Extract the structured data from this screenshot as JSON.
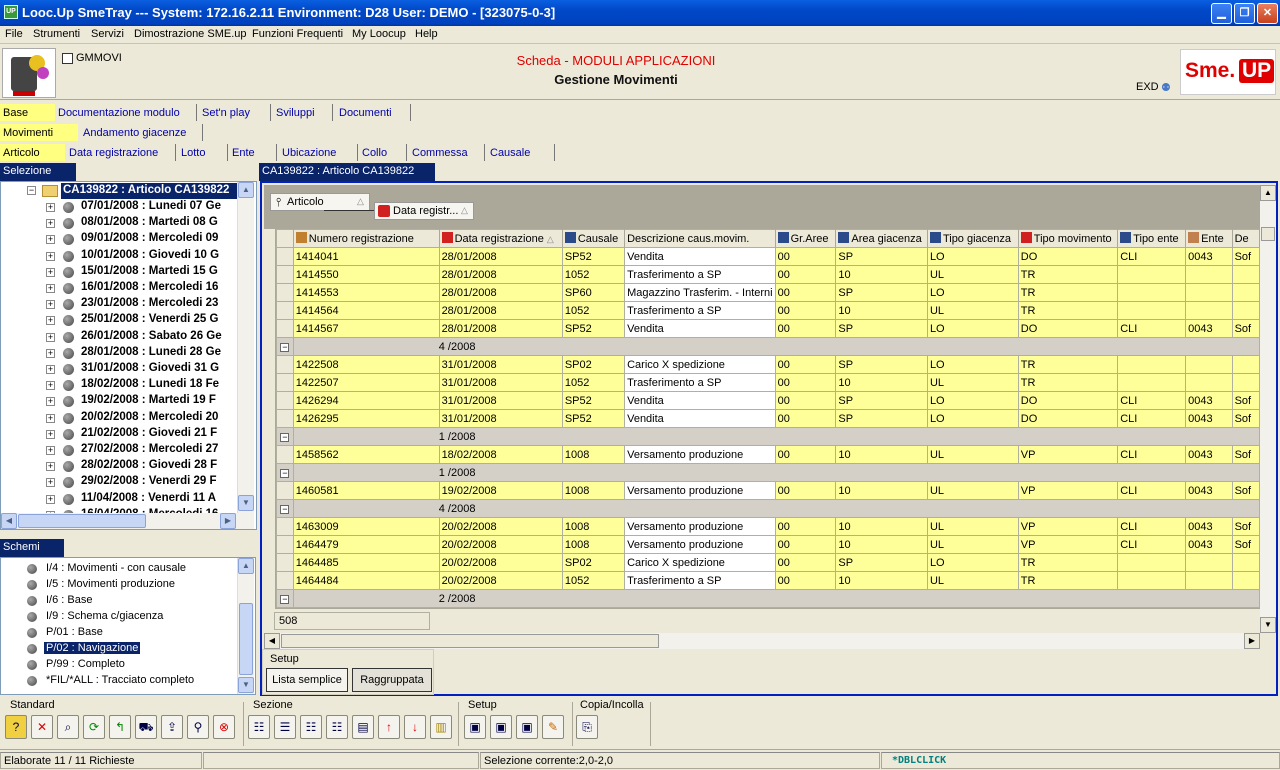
{
  "window": {
    "title": "Looc.Up SmeTray --- System: 172.16.2.11 Environment: D28 User: DEMO - [323075-0-3]",
    "app_icon": "UP"
  },
  "menu": [
    "File",
    "Strumenti",
    "Servizi",
    "Dimostrazione SME.up",
    "Funzioni Frequenti",
    "My Loocup",
    "Help"
  ],
  "header": {
    "code": "GMMOVI",
    "title1": "Scheda - MODULI APPLICAZIONI",
    "title2": "Gestione Movimenti",
    "exd": "EXD",
    "logo_text1": "Sme.",
    "logo_text2": "UP"
  },
  "tabs_row1": [
    "Base",
    "Documentazione modulo",
    "Set'n play",
    "Sviluppi",
    "Documenti"
  ],
  "tabs_row2": [
    "Movimenti",
    "Andamento giacenze"
  ],
  "tabs_row3": [
    "Articolo",
    "Data registrazione",
    "Lotto",
    "Ente",
    "Ubicazione",
    "Collo",
    "Commessa",
    "Causale"
  ],
  "selezione_label": "Selezione",
  "tree": {
    "root": "CA139822 : Articolo CA139822",
    "items": [
      "07/01/2008 : Lunedi 07 Ge",
      "08/01/2008 : Martedi 08 G",
      "09/01/2008 : Mercoledi 09",
      "10/01/2008 : Giovedi 10 G",
      "15/01/2008 : Martedi 15 G",
      "16/01/2008 : Mercoledi 16",
      "23/01/2008 : Mercoledi 23",
      "25/01/2008 : Venerdi 25 G",
      "26/01/2008 : Sabato 26 Ge",
      "28/01/2008 : Lunedi 28 Ge",
      "31/01/2008 : Giovedi 31 G",
      "18/02/2008 : Lunedi 18 Fe",
      "19/02/2008 : Martedi 19 F",
      "20/02/2008 : Mercoledi 20",
      "21/02/2008 : Giovedi 21 F",
      "27/02/2008 : Mercoledi 27",
      "28/02/2008 : Giovedi 28 F",
      "29/02/2008 : Venerdi 29 F",
      "11/04/2008 : Venerdi 11 A",
      "16/04/2008 : Mercoledi 16"
    ]
  },
  "schemi_label": "Schemi",
  "schemi": [
    "I/4 : Movimenti - con causale",
    "I/5 : Movimenti produzione",
    "I/6 : Base",
    "I/9 : Schema c/giacenza",
    "P/01 : Base",
    "P/02 : Navigazione",
    "P/99 : Completo",
    "*FIL/*ALL : Tracciato completo"
  ],
  "main_tab": "CA139822 : Articolo CA139822",
  "group_chips": [
    "Articolo",
    "Data registr..."
  ],
  "columns": [
    "Numero registrazione",
    "Data registrazione",
    "Causale",
    "Descrizione caus.movim.",
    "Gr.Aree",
    "Area giacenza",
    "Tipo giacenza",
    "Tipo movimento",
    "Tipo ente",
    "Ente",
    "De"
  ],
  "rows": [
    {
      "type": "data",
      "cells": [
        "1414041",
        "28/01/2008",
        "SP52",
        "Vendita",
        "00",
        "SP",
        "LO",
        "DO",
        "CLI",
        "0043",
        "Sof"
      ]
    },
    {
      "type": "data",
      "cells": [
        "1414550",
        "28/01/2008",
        "1052",
        "Trasferimento a SP",
        "00",
        "10",
        "UL",
        "TR",
        "",
        "",
        ""
      ]
    },
    {
      "type": "data",
      "cells": [
        "1414553",
        "28/01/2008",
        "SP60",
        "Magazzino Trasferim. - Interni",
        "00",
        "SP",
        "LO",
        "TR",
        "",
        "",
        ""
      ]
    },
    {
      "type": "data",
      "cells": [
        "1414564",
        "28/01/2008",
        "1052",
        "Trasferimento a SP",
        "00",
        "10",
        "UL",
        "TR",
        "",
        "",
        ""
      ]
    },
    {
      "type": "data",
      "cells": [
        "1414567",
        "28/01/2008",
        "SP52",
        "Vendita",
        "00",
        "SP",
        "LO",
        "DO",
        "CLI",
        "0043",
        "Sof"
      ]
    },
    {
      "type": "group",
      "label": "4 /2008"
    },
    {
      "type": "data",
      "cells": [
        "1422508",
        "31/01/2008",
        "SP02",
        "Carico X spedizione",
        "00",
        "SP",
        "LO",
        "TR",
        "",
        "",
        ""
      ]
    },
    {
      "type": "data",
      "cells": [
        "1422507",
        "31/01/2008",
        "1052",
        "Trasferimento a SP",
        "00",
        "10",
        "UL",
        "TR",
        "",
        "",
        ""
      ]
    },
    {
      "type": "data",
      "cells": [
        "1426294",
        "31/01/2008",
        "SP52",
        "Vendita",
        "00",
        "SP",
        "LO",
        "DO",
        "CLI",
        "0043",
        "Sof"
      ]
    },
    {
      "type": "data",
      "cells": [
        "1426295",
        "31/01/2008",
        "SP52",
        "Vendita",
        "00",
        "SP",
        "LO",
        "DO",
        "CLI",
        "0043",
        "Sof"
      ]
    },
    {
      "type": "group",
      "label": "1 /2008"
    },
    {
      "type": "data",
      "cells": [
        "1458562",
        "18/02/2008",
        "1008",
        "Versamento produzione",
        "00",
        "10",
        "UL",
        "VP",
        "CLI",
        "0043",
        "Sof"
      ]
    },
    {
      "type": "group",
      "label": "1 /2008"
    },
    {
      "type": "data",
      "cells": [
        "1460581",
        "19/02/2008",
        "1008",
        "Versamento produzione",
        "00",
        "10",
        "UL",
        "VP",
        "CLI",
        "0043",
        "Sof"
      ]
    },
    {
      "type": "group",
      "label": "4 /2008"
    },
    {
      "type": "data",
      "cells": [
        "1463009",
        "20/02/2008",
        "1008",
        "Versamento produzione",
        "00",
        "10",
        "UL",
        "VP",
        "CLI",
        "0043",
        "Sof"
      ]
    },
    {
      "type": "data",
      "cells": [
        "1464479",
        "20/02/2008",
        "1008",
        "Versamento produzione",
        "00",
        "10",
        "UL",
        "VP",
        "CLI",
        "0043",
        "Sof"
      ]
    },
    {
      "type": "data",
      "cells": [
        "1464485",
        "20/02/2008",
        "SP02",
        "Carico X spedizione",
        "00",
        "SP",
        "LO",
        "TR",
        "",
        "",
        ""
      ]
    },
    {
      "type": "data",
      "cells": [
        "1464484",
        "20/02/2008",
        "1052",
        "Trasferimento a SP",
        "00",
        "10",
        "UL",
        "TR",
        "",
        "",
        ""
      ]
    },
    {
      "type": "group",
      "label": "2 /2008"
    }
  ],
  "grid_count": "508",
  "setup_group": "Setup",
  "setup_buttons": [
    "Lista semplice",
    "Raggruppata"
  ],
  "toolbar_groups": [
    "Standard",
    "Sezione",
    "Setup",
    "Copia/Incolla"
  ],
  "status": {
    "left": "Elaborate 11 / 11 Richieste",
    "middle": "Selezione corrente:2,0-2,0",
    "right": "*DBLCLICK"
  }
}
